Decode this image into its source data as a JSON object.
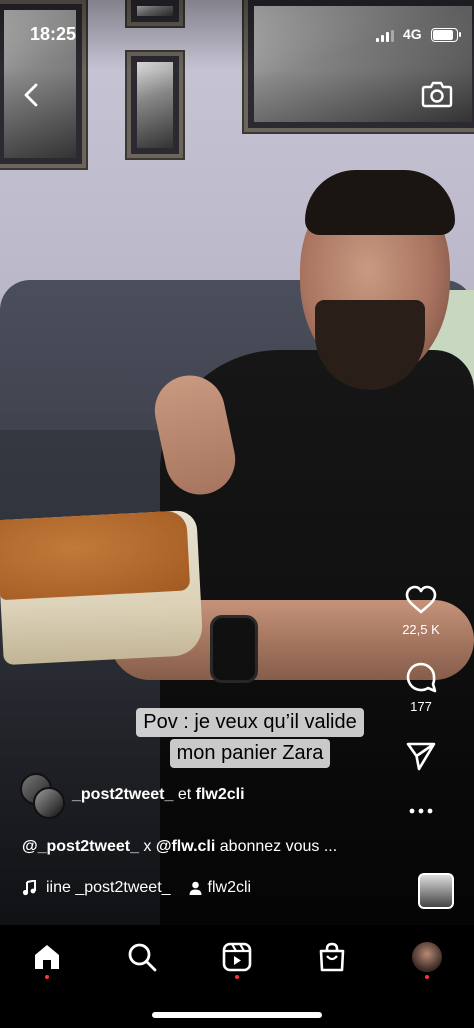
{
  "status_bar": {
    "time": "18:25",
    "network": "4G",
    "battery_level": 0.8
  },
  "top_bar": {
    "back_icon": "chevron-left-icon",
    "camera_icon": "camera-icon"
  },
  "video": {
    "caption_lines": [
      "Pov : je veux qu’il valide",
      "mon panier Zara"
    ]
  },
  "actions": {
    "like_count": "22,5 K",
    "comment_count": "177"
  },
  "authors": {
    "primary": "_post2tweet_",
    "joiner": " et ",
    "secondary": "flw2cli"
  },
  "description": {
    "mention1": "@_post2tweet_",
    "joiner": " x ",
    "mention2": "@flw.cli",
    "text": " abonnez vous ..."
  },
  "audio": {
    "track": "iine _post2tweet_",
    "collab": "flw2cli"
  },
  "nav": {
    "items": [
      "home-icon",
      "search-icon",
      "reels-icon",
      "shop-icon",
      "profile-avatar"
    ],
    "accent": "#ff3040"
  }
}
